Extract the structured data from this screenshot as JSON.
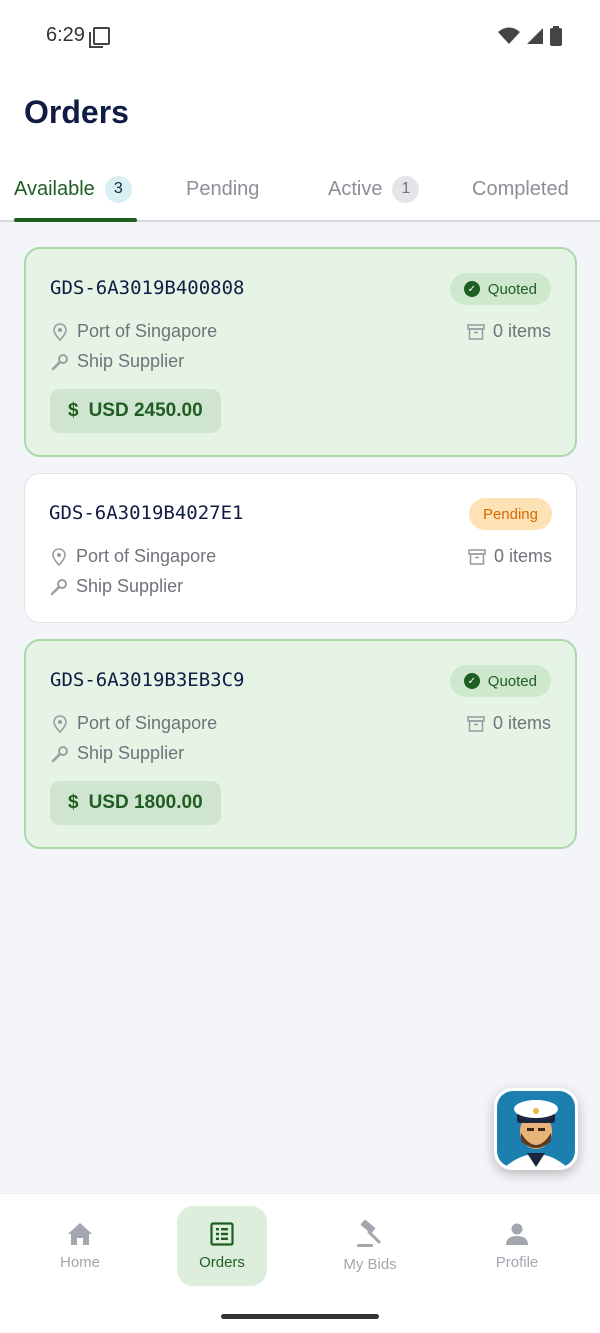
{
  "status_bar": {
    "time": "6:29"
  },
  "header": {
    "title": "Orders"
  },
  "tabs": [
    {
      "label": "Available",
      "count": "3"
    },
    {
      "label": "Pending"
    },
    {
      "label": "Active",
      "count": "1"
    },
    {
      "label": "Completed"
    }
  ],
  "orders": [
    {
      "id": "GDS-6A3019B400808",
      "status": "Quoted",
      "location": "Port of Singapore",
      "supplier": "Ship Supplier",
      "items": "0 items",
      "price": "USD 2450.00"
    },
    {
      "id": "GDS-6A3019B4027E1",
      "status": "Pending",
      "location": "Port of Singapore",
      "supplier": "Ship Supplier",
      "items": "0 items"
    },
    {
      "id": "GDS-6A3019B3EB3C9",
      "status": "Quoted",
      "location": "Port of Singapore",
      "supplier": "Ship Supplier",
      "items": "0 items",
      "price": "USD 1800.00"
    }
  ],
  "price_symbol": "$",
  "bottom_nav": [
    {
      "label": "Home",
      "icon": "home-icon"
    },
    {
      "label": "Orders",
      "icon": "list-icon"
    },
    {
      "label": "My Bids",
      "icon": "gavel-icon"
    },
    {
      "label": "Profile",
      "icon": "person-icon"
    }
  ],
  "colors": {
    "accent": "#1e5e22",
    "title": "#0f1d45",
    "quoted_card_bg": "#e6f4e6",
    "pending_badge": "#fde2b5"
  }
}
